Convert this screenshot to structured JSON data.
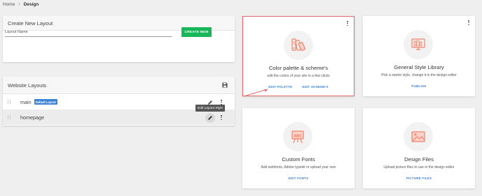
{
  "breadcrumb": {
    "home": "Home",
    "separator": "›",
    "current": "Design"
  },
  "create_layout": {
    "title": "Create New Layout",
    "name_label": "Layout Name",
    "button_label": "CREATE NEW"
  },
  "website_layouts": {
    "title": "Website Layouts",
    "rows": [
      {
        "name": "main",
        "badge": "Default Layout"
      },
      {
        "name": "homepage"
      }
    ],
    "tooltip": "Edit Layout Style"
  },
  "cards": [
    {
      "title": "Color palette & scheme's",
      "description": "edit the colors of your site in a few clicks",
      "links": [
        "EDIT PALETTE",
        "EDIT SCHEME'S"
      ],
      "icon": "palette-icon"
    },
    {
      "title": "General Style Library",
      "description": "Pick a starter style, change it in the design editor",
      "links": [
        "PUBLISH"
      ],
      "icon": "style-library-icon"
    },
    {
      "title": "Custom Fonts",
      "description": "Add webfonts, Adobe typekit or upload your own",
      "links": [
        "EDIT FONTS"
      ],
      "icon": "font-easel-icon"
    },
    {
      "title": "Design Files",
      "description": "Upload picture files to use in the design editor",
      "links": [
        "PICTURE FILES"
      ],
      "icon": "picture-files-icon"
    }
  ],
  "colors": {
    "accent_green": "#19b75a",
    "link_blue": "#3d84d8",
    "highlight_red": "#e26a6a",
    "icon_orange": "#f0826a"
  }
}
